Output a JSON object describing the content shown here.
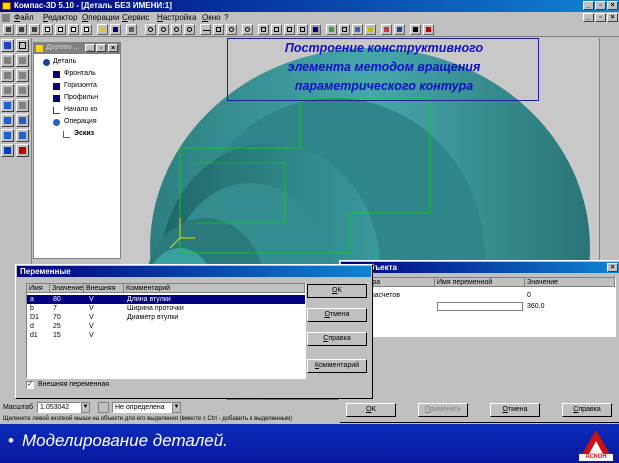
{
  "app": {
    "title": "Компас-3D 5.10 - [Деталь БЕЗ ИМЕНИ:1]",
    "min_glyph": "_",
    "max_glyph": "▫",
    "close_glyph": "×"
  },
  "menu": [
    "Файл",
    "Редактор",
    "Операции",
    "Сервис",
    "Настройка",
    "Окно",
    "?"
  ],
  "tree": {
    "title": "Дерево ...",
    "items": [
      {
        "label": "Деталь",
        "icon": "part-icon"
      },
      {
        "label": "Фронталь",
        "icon": "plane-icon"
      },
      {
        "label": "Горизонта",
        "icon": "plane-icon"
      },
      {
        "label": "Профильн",
        "icon": "plane-icon"
      },
      {
        "label": "Начало ко",
        "icon": "axes-icon"
      },
      {
        "label": "Операция",
        "icon": "rotation-icon"
      },
      {
        "label": "Эскиз",
        "icon": "sketch-icon"
      }
    ]
  },
  "annotation": {
    "line1": "Построение конструктивного",
    "line2": "элемента  методом вращения",
    "line3": "параметрического контура"
  },
  "variables_dialog": {
    "title": "Переменные",
    "columns": [
      "Имя",
      "Значение",
      "Внешняя",
      "Комментарий"
    ],
    "rows": [
      {
        "name": "a",
        "value": "80",
        "external": "V",
        "comment": "Длина втулки"
      },
      {
        "name": "b",
        "value": "7",
        "external": "V",
        "comment": "Ширина проточки"
      },
      {
        "name": "D1",
        "value": "70",
        "external": "V",
        "comment": "Диаметр втулки"
      },
      {
        "name": "d",
        "value": "25",
        "external": "V",
        "comment": ""
      },
      {
        "name": "d1",
        "value": "15",
        "external": "V",
        "comment": ""
      }
    ],
    "buttons": {
      "ok": "OK",
      "cancel": "Отмена",
      "help": "Справка",
      "comment": "Комментарий"
    },
    "checkbox_label": "Внешняя переменная",
    "checkbox_checked": true
  },
  "params_dialog": {
    "title": "...ры объекта",
    "columns": [
      "...раметра",
      "Имя переменной",
      "Значение"
    ],
    "rows": [
      {
        "param": "...ть из расчетов",
        "var": "",
        "value": "0"
      },
      {
        "param": "",
        "var": "",
        "value": "360.0"
      }
    ],
    "buttons": {
      "ok": "OK",
      "apply": "Применить",
      "cancel": "Отмена",
      "help": "Справка"
    }
  },
  "status": {
    "scale_label": "Масштаб",
    "scale_value": "1.053042",
    "state_value": "Не определена",
    "hint": "Щелкните левой кнопкой мыши на объекте для его выделения (вместе с Ctrl - добавить к выделенным)"
  },
  "banner": {
    "bullet": "•",
    "text": "Моделирование деталей."
  },
  "logo_text": "АСКОН",
  "colors": {
    "titlebar": "#000080",
    "part_surface": "#3a9a9a",
    "sketch_lines": "#00d000",
    "annotation_text": "#1010c8",
    "banner": "#0b2bb8"
  }
}
